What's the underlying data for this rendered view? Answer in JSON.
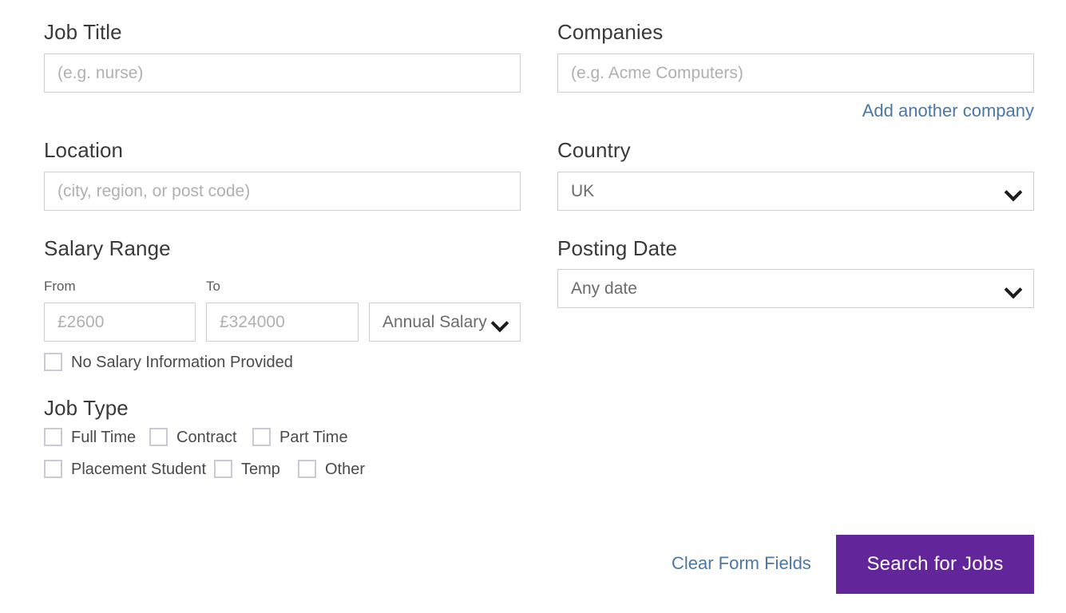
{
  "form": {
    "job_title": {
      "label": "Job Title",
      "placeholder": "(e.g. nurse)",
      "value": ""
    },
    "companies": {
      "label": "Companies",
      "placeholder": "(e.g. Acme Computers)",
      "value": "",
      "add_another_link": "Add another company"
    },
    "location": {
      "label": "Location",
      "placeholder": "(city, region, or post code)",
      "value": ""
    },
    "country": {
      "label": "Country",
      "selected": "UK",
      "icon": "chevron-down-icon"
    },
    "salary_range": {
      "label": "Salary Range",
      "from_label": "From",
      "to_label": "To",
      "from_placeholder": "£2600",
      "to_placeholder": "£324000",
      "from_value": "",
      "to_value": "",
      "type_selected": "Annual Salary",
      "type_icon": "chevron-down-icon",
      "no_salary_checkbox": {
        "label": "No Salary Information Provided",
        "checked": false
      }
    },
    "posting_date": {
      "label": "Posting Date",
      "selected": "Any date",
      "icon": "chevron-down-icon"
    },
    "job_type": {
      "label": "Job Type",
      "options": [
        {
          "label": "Full Time",
          "checked": false
        },
        {
          "label": "Contract",
          "checked": false
        },
        {
          "label": "Part Time",
          "checked": false
        },
        {
          "label": "Placement Student",
          "checked": false
        },
        {
          "label": "Temp",
          "checked": false
        },
        {
          "label": "Other",
          "checked": false
        }
      ]
    }
  },
  "actions": {
    "clear_label": "Clear Form Fields",
    "search_label": "Search for Jobs"
  },
  "colors": {
    "primary_button": "#63269A",
    "link": "#4B77A6",
    "field_border": "#CFCFCF",
    "checkbox_border": "#C9C9D8",
    "heading_text": "#3A3A3A",
    "placeholder_text": "#B0B0B0"
  }
}
